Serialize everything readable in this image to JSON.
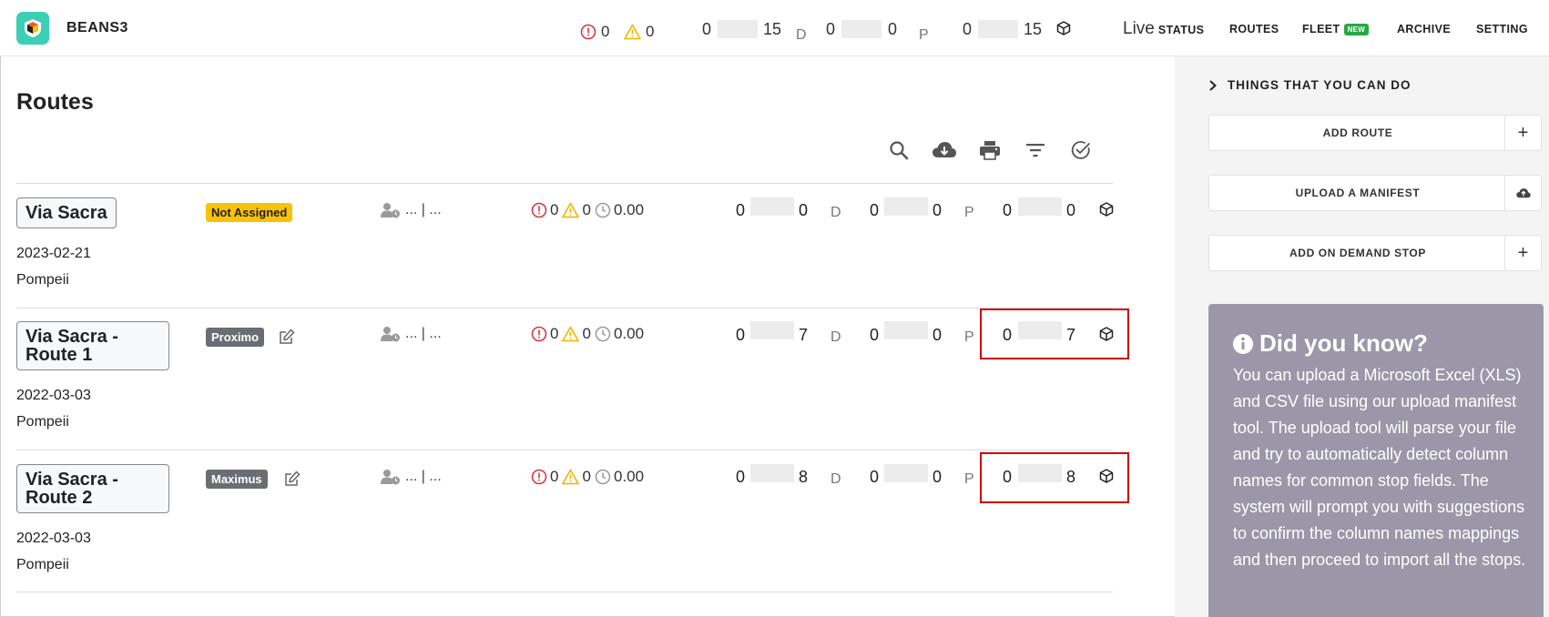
{
  "header": {
    "brand": "BEANS3",
    "alerts": {
      "errors": "0",
      "warnings": "0"
    },
    "counters": [
      {
        "left": "0",
        "right": "15",
        "letter": "D"
      },
      {
        "left": "0",
        "right": "0",
        "letter": "P"
      },
      {
        "left": "0",
        "right": "15",
        "icon": "package-icon"
      }
    ],
    "nav": {
      "live_prefix": "Live",
      "status": "STATUS",
      "routes": "ROUTES",
      "fleet": "FLEET",
      "fleet_badge": "NEW",
      "archive": "ARCHIVE",
      "setting": "SETTING"
    }
  },
  "main": {
    "title": "Routes",
    "toolbar": [
      "search-icon",
      "cloud-download-icon",
      "print-icon",
      "filter-icon",
      "check-circle-icon"
    ],
    "routes": [
      {
        "name": "Via Sacra",
        "date": "2023-02-21",
        "city": "Pompeii",
        "tag": "Not Assigned",
        "driver": "... | ...",
        "errors": "0",
        "warnings": "0",
        "time": "0.00",
        "d_left": "0",
        "d_right": "0",
        "d_letter": "D",
        "p_left": "0",
        "p_right": "0",
        "p_letter": "P",
        "pk_left": "0",
        "pk_right": "0"
      },
      {
        "name": "Via Sacra - Route 1",
        "date": "2022-03-03",
        "city": "Pompeii",
        "tag": "Proximo",
        "driver": "... | ...",
        "errors": "0",
        "warnings": "0",
        "time": "0.00",
        "d_left": "0",
        "d_right": "7",
        "d_letter": "D",
        "p_left": "0",
        "p_right": "0",
        "p_letter": "P",
        "pk_left": "0",
        "pk_right": "7"
      },
      {
        "name": "Via Sacra - Route 2",
        "date": "2022-03-03",
        "city": "Pompeii",
        "tag": "Maximus",
        "driver": "... | ...",
        "errors": "0",
        "warnings": "0",
        "time": "0.00",
        "d_left": "0",
        "d_right": "8",
        "d_letter": "D",
        "p_left": "0",
        "p_right": "0",
        "p_letter": "P",
        "pk_left": "0",
        "pk_right": "8"
      }
    ]
  },
  "sidebar": {
    "heading": "THINGS THAT YOU CAN DO",
    "buttons": [
      {
        "label": "ADD ROUTE",
        "icon": "+"
      },
      {
        "label": "UPLOAD A MANIFEST",
        "icon": "cloud-upload-icon"
      },
      {
        "label": "ADD ON DEMAND STOP",
        "icon": "+"
      }
    ],
    "did_you_know": {
      "title": "Did you know?",
      "text": "You can upload a Microsoft Excel (XLS) and CSV file using our upload manifest tool. The upload tool will parse your file and try to automatically detect column names for common stop fields. The system will prompt you with suggestions to confirm the column names mappings and then proceed to import all the stops."
    }
  },
  "colors": {
    "accent": "#3ccfb4",
    "error": "#dc3545",
    "warning": "#f0b400",
    "highlight": "#cc0000",
    "tip_bg": "#9b97a9"
  }
}
